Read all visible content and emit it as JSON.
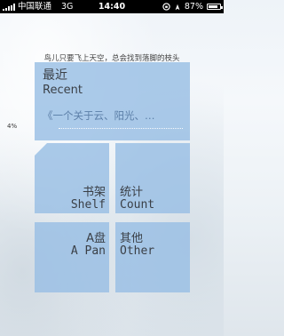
{
  "status_bar": {
    "carrier": "中国联通",
    "network": "3G",
    "time": "14:40",
    "battery": "87%",
    "battery_level": 0.87
  },
  "quote": "鸟儿只要飞上天空，总会找到落脚的枝头",
  "recent": {
    "title_zh": "最近",
    "title_en": "Recent",
    "book": "《一个关于云、阳光、…",
    "progress": "4%"
  },
  "tiles": {
    "shelf": {
      "zh": "书架",
      "en": "Shelf"
    },
    "count": {
      "zh": "统计",
      "en": "Count"
    },
    "apan": {
      "zh": "A盘",
      "en": "A Pan"
    },
    "other": {
      "zh": "其他",
      "en": "Other"
    }
  }
}
